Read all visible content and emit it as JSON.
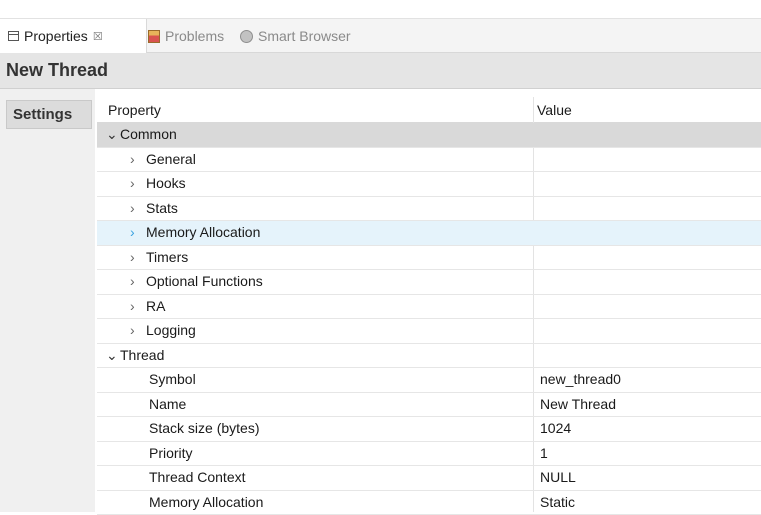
{
  "tabs": [
    {
      "label": "Properties",
      "icon": "properties-icon",
      "close": "☒"
    },
    {
      "label": "Problems",
      "icon": "problems-icon"
    },
    {
      "label": "Smart Browser",
      "icon": "smart-browser-icon"
    }
  ],
  "title": "New Thread",
  "settings_tab": "Settings",
  "grid": {
    "header": {
      "property": "Property",
      "value": "Value"
    },
    "common_group": {
      "label": "Common",
      "expanded": true
    },
    "common_items": [
      {
        "label": "General"
      },
      {
        "label": "Hooks"
      },
      {
        "label": "Stats"
      },
      {
        "label": "Memory Allocation",
        "selected": true
      },
      {
        "label": "Timers"
      },
      {
        "label": "Optional Functions"
      },
      {
        "label": "RA"
      },
      {
        "label": "Logging"
      }
    ],
    "thread_group": {
      "label": "Thread",
      "expanded": true
    },
    "thread_props": [
      {
        "label": "Symbol",
        "value": "new_thread0"
      },
      {
        "label": "Name",
        "value": "New Thread"
      },
      {
        "label": "Stack size (bytes)",
        "value": "1024"
      },
      {
        "label": "Priority",
        "value": "1"
      },
      {
        "label": "Thread Context",
        "value": "NULL"
      },
      {
        "label": "Memory Allocation",
        "value": "Static"
      }
    ]
  },
  "colors": {
    "selected_row": "#e5f3fb",
    "group_row": "#d9d9d9",
    "accent_chevron": "#3aa2e0"
  }
}
